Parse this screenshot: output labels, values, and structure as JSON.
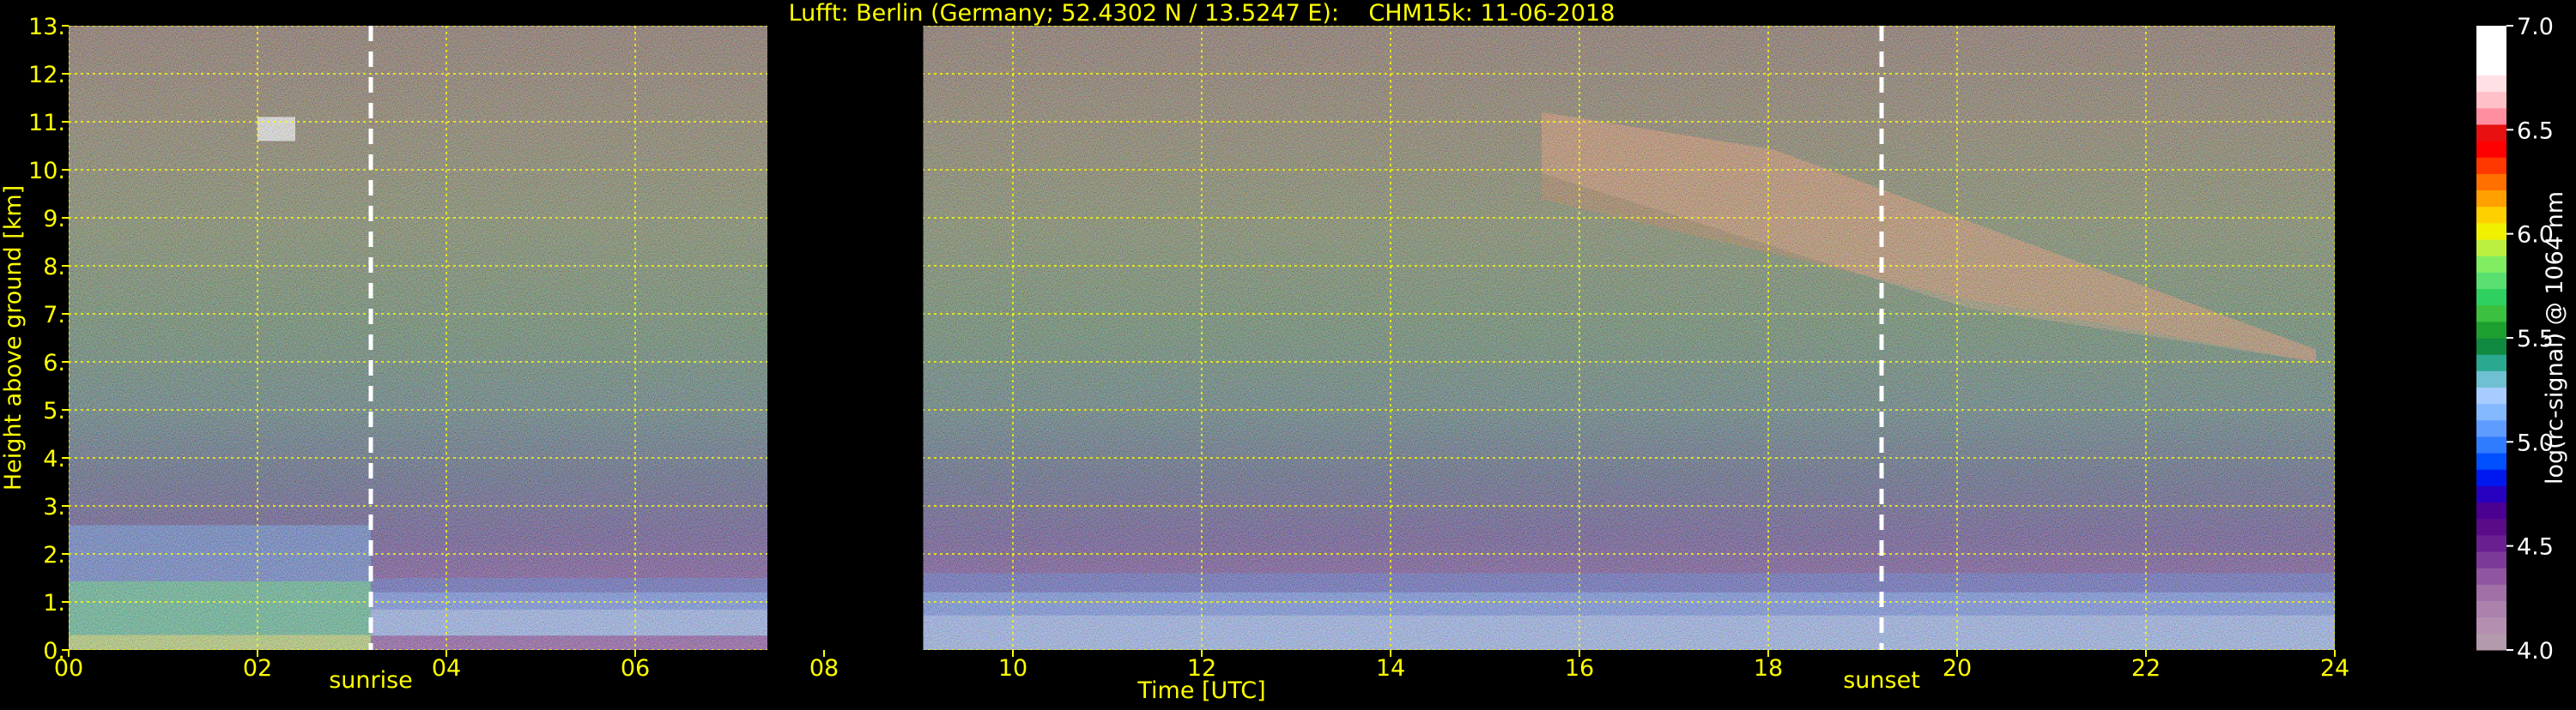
{
  "chart_data": {
    "type": "heatmap",
    "title": "Lufft: Berlin (Germany; 52.4302 N / 13.5247 E):    CHM15k: 11-06-2018",
    "xlabel": "Time [UTC]",
    "ylabel": "Height above ground [km]",
    "xlim": [
      0,
      24
    ],
    "ylim": [
      0,
      13
    ],
    "x_ticks": [
      "00",
      "02",
      "04",
      "06",
      "08",
      "10",
      "12",
      "14",
      "16",
      "18",
      "20",
      "22",
      "24"
    ],
    "y_ticks": [
      "0.",
      "1.",
      "2.",
      "3.",
      "4.",
      "5.",
      "6.",
      "7.",
      "8.",
      "9.",
      "10.",
      "11.",
      "12.",
      "13."
    ],
    "grid": true,
    "grid_color": "#ffff00",
    "annotations": [
      {
        "label": "sunrise",
        "time": 3.2
      },
      {
        "label": "sunset",
        "time": 19.2
      }
    ],
    "data_gap": {
      "start": 7.4,
      "end": 9.05
    },
    "colorbar": {
      "label": "log(rc-signal) @ 1064 nm",
      "range": [
        4.0,
        7.0
      ],
      "ticks": [
        "4.0",
        "4.5",
        "5.0",
        "5.5",
        "6.0",
        "6.5",
        "7.0"
      ],
      "colors": [
        "#b39aac",
        "#b48fb0",
        "#aa82ac",
        "#a070a6",
        "#8f55a0",
        "#7c3a98",
        "#6a1f90",
        "#5a0c88",
        "#4a0090",
        "#2800c0",
        "#0018f0",
        "#0050ff",
        "#2f7cff",
        "#5e9cff",
        "#84b8ff",
        "#a8ccff",
        "#6fc0d0",
        "#2aa890",
        "#108a40",
        "#1ea030",
        "#3cc040",
        "#2ed060",
        "#5ae070",
        "#80ee60",
        "#bcf040",
        "#f0f000",
        "#ffd000",
        "#ffa000",
        "#ff7000",
        "#ff3800",
        "#ff0000",
        "#e81010",
        "#ff8fa0",
        "#ffc0c8",
        "#ffe0e4",
        "#ffffff",
        "#ffffff",
        "#ffffff"
      ]
    },
    "features": [
      {
        "type": "aerosol_layer",
        "x_range": [
          0,
          3.2
        ],
        "top_km": 2.6,
        "bottom_km": 0
      },
      {
        "type": "boundary_layer",
        "x_range": [
          3.2,
          7.4
        ],
        "top_km": 1.5,
        "bottom_km": 0.3
      },
      {
        "type": "boundary_layer",
        "x_range": [
          9.05,
          24
        ],
        "top_km": 1.6,
        "bottom_km": 0
      },
      {
        "type": "cirrus",
        "x_range": [
          15.6,
          23.8
        ],
        "top_km": 11.2,
        "bottom_km": 6.0
      },
      {
        "type": "cloud",
        "x_range": [
          2.0,
          2.4
        ],
        "top_km": 11.1,
        "bottom_km": 10.6
      }
    ]
  }
}
